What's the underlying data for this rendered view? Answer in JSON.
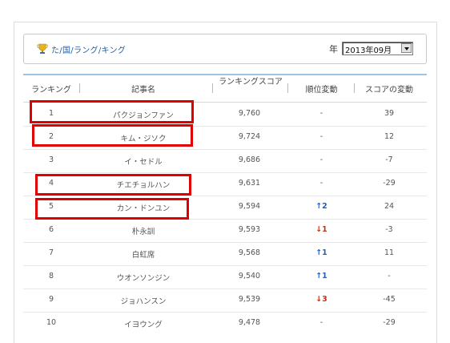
{
  "header": {
    "title": "た/国/ラング/キング",
    "year_label": "年",
    "period_value": "2013年09月"
  },
  "columns": {
    "rank": "ランキング",
    "name": "記事名",
    "score": "ランキングスコア",
    "change": "順位変動",
    "delta": "スコアの変動"
  },
  "rows": [
    {
      "rank": "1",
      "name": "パクジョンファン",
      "score": "9,760",
      "change": "-",
      "delta": "39"
    },
    {
      "rank": "2",
      "name": "キム・ジソク",
      "score": "9,724",
      "change": "-",
      "delta": "12"
    },
    {
      "rank": "3",
      "name": "イ・セドル",
      "score": "9,686",
      "change": "-",
      "delta": "-7"
    },
    {
      "rank": "4",
      "name": "チエチョルハン",
      "score": "9,631",
      "change": "-",
      "delta": "-29"
    },
    {
      "rank": "5",
      "name": "カン・ドンユン",
      "score": "9,594",
      "change": "↑2",
      "delta": "24"
    },
    {
      "rank": "6",
      "name": "朴永訓",
      "score": "9,593",
      "change": "↓1",
      "delta": "-3"
    },
    {
      "rank": "7",
      "name": "白虹席",
      "score": "9,568",
      "change": "↑1",
      "delta": "11"
    },
    {
      "rank": "8",
      "name": "ウオンソンジン",
      "score": "9,540",
      "change": "↑1",
      "delta": "-"
    },
    {
      "rank": "9",
      "name": "ジョハンスン",
      "score": "9,539",
      "change": "↓3",
      "delta": "-45"
    },
    {
      "rank": "10",
      "name": "イヨウング",
      "score": "9,478",
      "change": "-",
      "delta": "-29"
    }
  ],
  "colors": {
    "up": "#2060c0",
    "down": "#c83018",
    "highlight": "#e00000",
    "link": "#1d5fa8"
  },
  "icons": {
    "title_icon": "trophy-icon",
    "select_icon": "chevron-down-icon"
  }
}
